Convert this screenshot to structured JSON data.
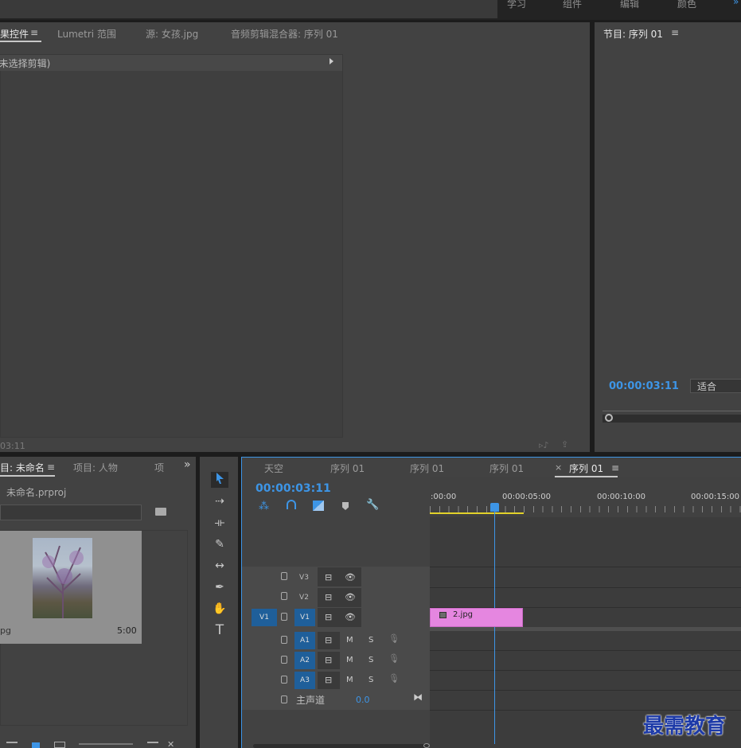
{
  "workspaces": [
    "学习",
    "组件",
    "编辑",
    "颜色"
  ],
  "top_panel": {
    "tabs": [
      "果控件",
      "Lumetri 范围",
      "源: 女孩.jpg",
      "音频剪辑混合器: 序列 01"
    ],
    "placeholder": "(未选择剪辑)",
    "timecode": "03:11"
  },
  "program": {
    "title": "节目: 序列 01",
    "timecode": "00:00:03:11",
    "fit": "适合"
  },
  "project": {
    "tabs": [
      "目: 未命名",
      "项目: 人物",
      "项"
    ],
    "file": "未命名.prproj",
    "clip_name": "pg",
    "clip_duration": "5:00"
  },
  "timeline": {
    "tabs": [
      "天空",
      "序列 01",
      "序列 01",
      "序列 01",
      "序列 01"
    ],
    "timecode": "00:00:03:11",
    "ruler": [
      ":00:00",
      "00:00:05:00",
      "00:00:10:00",
      "00:00:15:00"
    ],
    "tracks": {
      "video": [
        "V3",
        "V2",
        "V1"
      ],
      "audio": [
        "A1",
        "A2",
        "A3"
      ],
      "source_v": "V1",
      "mute": "M",
      "solo": "S",
      "master_label": "主声道",
      "master_value": "0.0"
    },
    "clip": "2.jpg"
  },
  "watermark": "最需教育",
  "colors": {
    "accent": "#3d95e6",
    "clip": "#e586e0",
    "work_area": "#e2d22a"
  }
}
